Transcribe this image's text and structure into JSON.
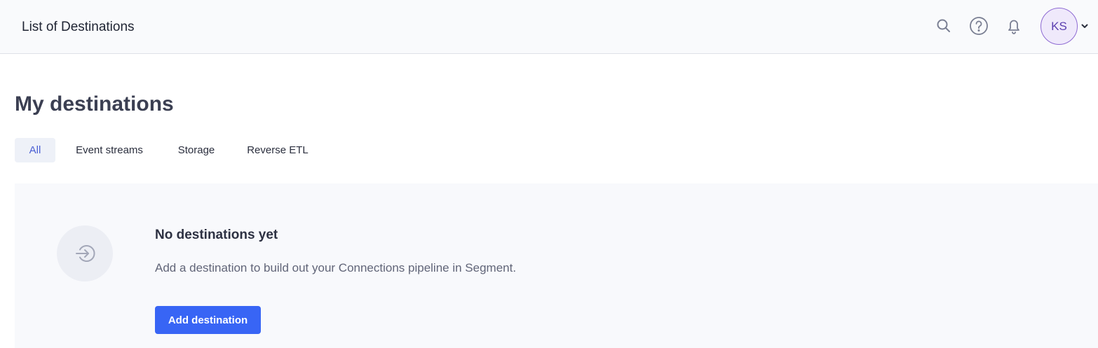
{
  "header": {
    "title": "List of Destinations",
    "icons": [
      "search-icon",
      "help-icon",
      "bell-icon"
    ],
    "avatar_initials": "KS"
  },
  "main": {
    "title": "My destinations",
    "tabs": [
      {
        "label": "All",
        "active": true
      },
      {
        "label": "Event streams",
        "active": false
      },
      {
        "label": "Storage",
        "active": false
      },
      {
        "label": "Reverse ETL",
        "active": false
      }
    ],
    "empty_state": {
      "icon": "arrow-right-circle-icon",
      "heading": "No destinations yet",
      "description": "Add a destination to build out your Connections pipeline in Segment.",
      "button_label": "Add destination"
    }
  },
  "colors": {
    "accent": "#3865f5",
    "active_tab_text": "#4a5fd4",
    "avatar_border": "#8e6ad3"
  }
}
